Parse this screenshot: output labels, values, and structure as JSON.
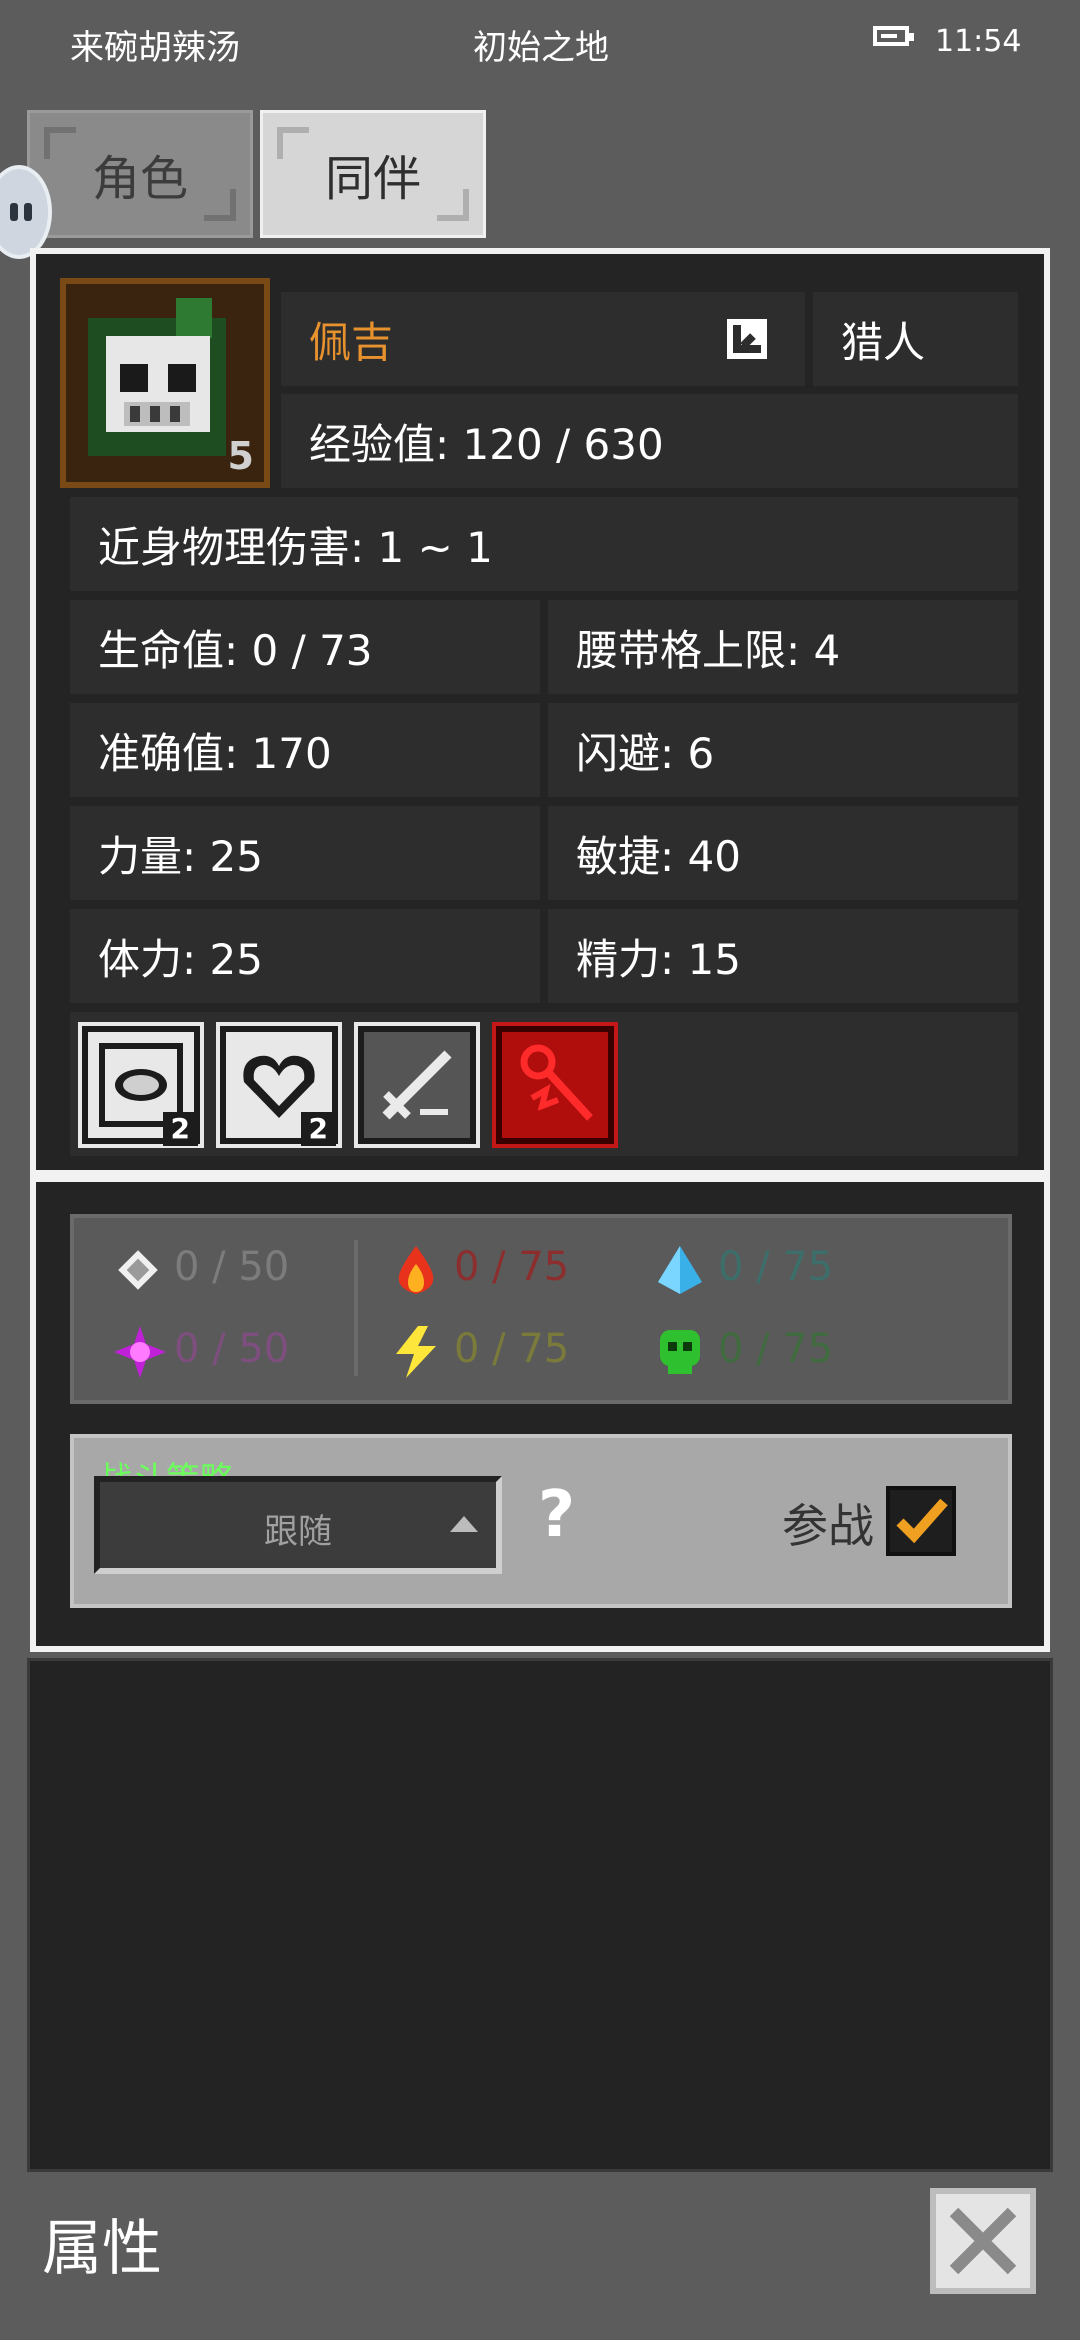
{
  "status_bar": {
    "left": "来碗胡辣汤",
    "center": "初始之地",
    "time": "11:54",
    "icon": "battery-icon"
  },
  "tabs": [
    {
      "label": "角色"
    },
    {
      "label": "同伴"
    }
  ],
  "companion": {
    "name": "佩吉",
    "level": "5",
    "class": "猎人",
    "exp_label": "经验值: 120 / 630",
    "melee": "近身物理伤害: 1 ~ 1",
    "stats": {
      "hp": "生命值: 0 / 73",
      "belt": "腰带格上限: 4",
      "accuracy": "准确值: 170",
      "dodge": "闪避: 6",
      "strength": "力量: 25",
      "agility": "敏捷: 40",
      "stamina": "体力: 25",
      "energy": "精力: 15"
    },
    "skills": [
      {
        "icon": "shield-eye-skill-icon",
        "count": "2"
      },
      {
        "icon": "heart-skill-icon",
        "count": "2"
      },
      {
        "icon": "sword-skill-icon"
      },
      {
        "icon": "red-staff-skill-icon"
      }
    ]
  },
  "resistances": {
    "physical": "0 / 50",
    "fire": "0 / 75",
    "ice": "0 / 75",
    "arcane": "0 / 50",
    "lightning": "0 / 75",
    "poison": "0 / 75",
    "colors": {
      "physical": "#7c7c7c",
      "fire": "#8c2e2e",
      "ice": "#3c6e6a",
      "arcane": "#7e4f7e",
      "lightning": "#7a7a3a",
      "poison": "#3f6b3f"
    }
  },
  "strategy": {
    "title": "战斗策略",
    "selected": "跟随",
    "join_label": "参战",
    "join_checked": true
  },
  "footer": {
    "title": "属性"
  },
  "colors": {
    "name": "#e8922e",
    "strategy_title": "#6aff5a"
  }
}
